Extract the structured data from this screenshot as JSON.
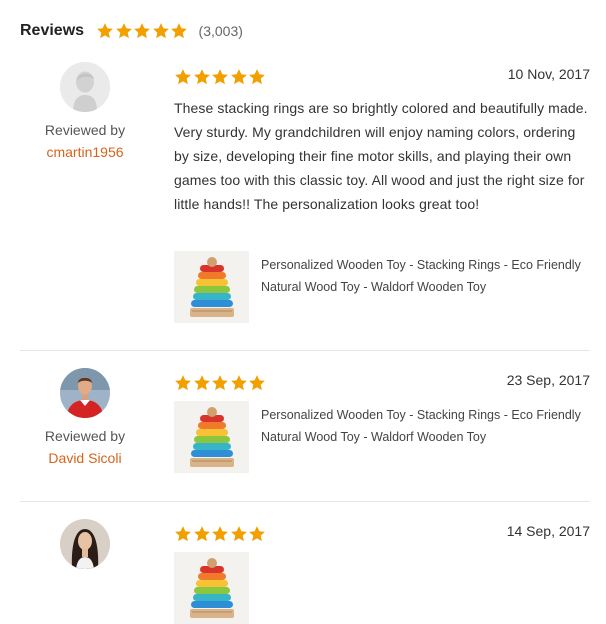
{
  "header": {
    "title": "Reviews",
    "rating": 5,
    "count": "(3,003)"
  },
  "colors": {
    "star": "#f1a000",
    "link": "#d5641c"
  },
  "reviews": [
    {
      "reviewed_by": "Reviewed by",
      "reviewer": "cmartin1956",
      "rating": 5,
      "date": "10 Nov, 2017",
      "text": "These stacking rings are so brightly colored and beautifully made. Very sturdy. My grandchildren will enjoy naming colors, ordering by size, developing their fine motor skills, and playing their own games too with this classic toy. All wood and just the right size for little hands!! The personalization looks great too!",
      "product": "Personalized Wooden Toy - Stacking Rings - Eco Friendly Natural Wood Toy - Waldorf Wooden Toy",
      "avatar_icon": "default-user-icon"
    },
    {
      "reviewed_by": "Reviewed by",
      "reviewer": "David Sicoli",
      "rating": 5,
      "date": "23 Sep, 2017",
      "text": "",
      "product": "Personalized Wooden Toy - Stacking Rings - Eco Friendly Natural Wood Toy - Waldorf Wooden Toy",
      "avatar_icon": "user-photo"
    },
    {
      "reviewed_by": "",
      "reviewer": "",
      "rating": 5,
      "date": "14 Sep, 2017",
      "text": "",
      "product": "",
      "avatar_icon": "user-photo"
    }
  ]
}
